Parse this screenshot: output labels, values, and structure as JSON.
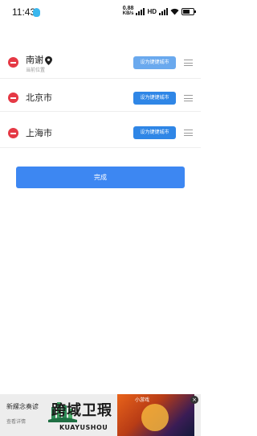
{
  "status_bar": {
    "time": "11:43",
    "net_speed_value": "0.88",
    "net_speed_unit": "KB/s",
    "hd_label": "HD"
  },
  "cities": [
    {
      "name": "南谢",
      "subtitle": "当前位置",
      "button": "设为键键城市"
    },
    {
      "name": "北京市",
      "subtitle": "",
      "button": "设为键键城市"
    },
    {
      "name": "上海市",
      "subtitle": "",
      "button": "设为键键城市"
    }
  ],
  "done_button": "完成",
  "ad": {
    "title": "新縲念奏谚",
    "subtitle": "查看详情",
    "image_caption": "小游戏",
    "close": "×"
  },
  "watermark": {
    "text": "跨域卫瑕",
    "sub": "KUAYUSHOU"
  },
  "colors": {
    "remove": "#e53945",
    "button_light": "#6aa9ee",
    "button_dark": "#2f86e6",
    "done": "#3d87f2"
  }
}
